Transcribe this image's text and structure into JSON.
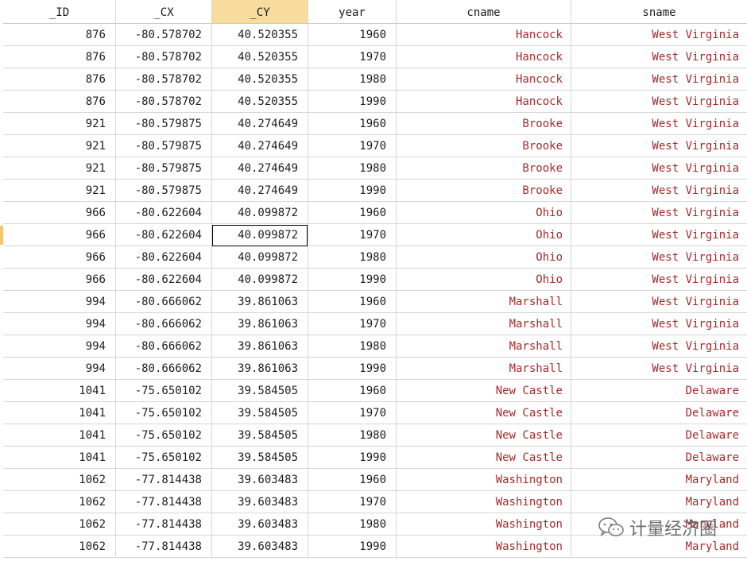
{
  "columns": [
    "_ID",
    "_CX",
    "_CY",
    "year",
    "cname",
    "sname"
  ],
  "active_column": "_CY",
  "selected_cell": {
    "row": 10,
    "column": "_CY"
  },
  "colors": {
    "active_header": "#f7dc9e",
    "string_text": "#a52a2a",
    "row_marker": "#f2c66d"
  },
  "rows": [
    [
      "876",
      "-80.578702",
      "40.520355",
      "1960",
      "Hancock",
      "West Virginia"
    ],
    [
      "876",
      "-80.578702",
      "40.520355",
      "1970",
      "Hancock",
      "West Virginia"
    ],
    [
      "876",
      "-80.578702",
      "40.520355",
      "1980",
      "Hancock",
      "West Virginia"
    ],
    [
      "876",
      "-80.578702",
      "40.520355",
      "1990",
      "Hancock",
      "West Virginia"
    ],
    [
      "921",
      "-80.579875",
      "40.274649",
      "1960",
      "Brooke",
      "West Virginia"
    ],
    [
      "921",
      "-80.579875",
      "40.274649",
      "1970",
      "Brooke",
      "West Virginia"
    ],
    [
      "921",
      "-80.579875",
      "40.274649",
      "1980",
      "Brooke",
      "West Virginia"
    ],
    [
      "921",
      "-80.579875",
      "40.274649",
      "1990",
      "Brooke",
      "West Virginia"
    ],
    [
      "966",
      "-80.622604",
      "40.099872",
      "1960",
      "Ohio",
      "West Virginia"
    ],
    [
      "966",
      "-80.622604",
      "40.099872",
      "1970",
      "Ohio",
      "West Virginia"
    ],
    [
      "966",
      "-80.622604",
      "40.099872",
      "1980",
      "Ohio",
      "West Virginia"
    ],
    [
      "966",
      "-80.622604",
      "40.099872",
      "1990",
      "Ohio",
      "West Virginia"
    ],
    [
      "994",
      "-80.666062",
      "39.861063",
      "1960",
      "Marshall",
      "West Virginia"
    ],
    [
      "994",
      "-80.666062",
      "39.861063",
      "1970",
      "Marshall",
      "West Virginia"
    ],
    [
      "994",
      "-80.666062",
      "39.861063",
      "1980",
      "Marshall",
      "West Virginia"
    ],
    [
      "994",
      "-80.666062",
      "39.861063",
      "1990",
      "Marshall",
      "West Virginia"
    ],
    [
      "1041",
      "-75.650102",
      "39.584505",
      "1960",
      "New Castle",
      "Delaware"
    ],
    [
      "1041",
      "-75.650102",
      "39.584505",
      "1970",
      "New Castle",
      "Delaware"
    ],
    [
      "1041",
      "-75.650102",
      "39.584505",
      "1980",
      "New Castle",
      "Delaware"
    ],
    [
      "1041",
      "-75.650102",
      "39.584505",
      "1990",
      "New Castle",
      "Delaware"
    ],
    [
      "1062",
      "-77.814438",
      "39.603483",
      "1960",
      "Washington",
      "Maryland"
    ],
    [
      "1062",
      "-77.814438",
      "39.603483",
      "1970",
      "Washington",
      "Maryland"
    ],
    [
      "1062",
      "-77.814438",
      "39.603483",
      "1980",
      "Washington",
      "Maryland"
    ],
    [
      "1062",
      "-77.814438",
      "39.603483",
      "1990",
      "Washington",
      "Maryland"
    ]
  ],
  "watermark": {
    "text": "计量经济圈",
    "icon": "wechat-icon"
  }
}
